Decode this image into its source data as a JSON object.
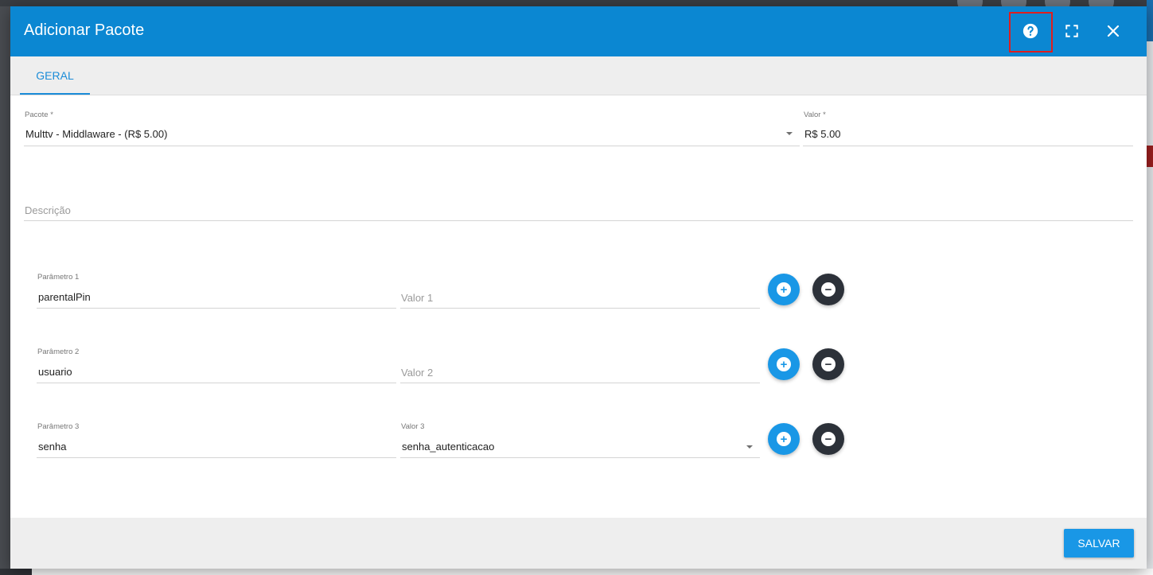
{
  "dialog": {
    "title": "Adicionar Pacote",
    "header_icons": [
      "help-icon",
      "fullscreen-icon",
      "close-icon"
    ]
  },
  "tabs": [
    {
      "label": "GERAL",
      "active": true
    }
  ],
  "form": {
    "pacote": {
      "label": "Pacote *",
      "value": "Multtv - Middlaware - (R$ 5.00)"
    },
    "valor": {
      "label": "Valor *",
      "value": "R$ 5.00"
    },
    "descricao": {
      "placeholder": "Descrição"
    },
    "params": [
      {
        "param_label": "Parâmetro 1",
        "param_value": "parentalPin",
        "value_label": "",
        "value_placeholder": "Valor 1",
        "value_value": ""
      },
      {
        "param_label": "Parâmetro 2",
        "param_value": "usuario",
        "value_label": "",
        "value_placeholder": "Valor 2",
        "value_value": ""
      },
      {
        "param_label": "Parâmetro 3",
        "param_value": "senha",
        "value_label": "Valor 3",
        "value_placeholder": "",
        "value_value": "senha_autenticacao"
      }
    ]
  },
  "footer": {
    "save_label": "SALVAR"
  },
  "colors": {
    "header": "#0b87d2",
    "accent": "#1997e6",
    "remove": "#2c3139",
    "highlight": "#e01d1d"
  }
}
